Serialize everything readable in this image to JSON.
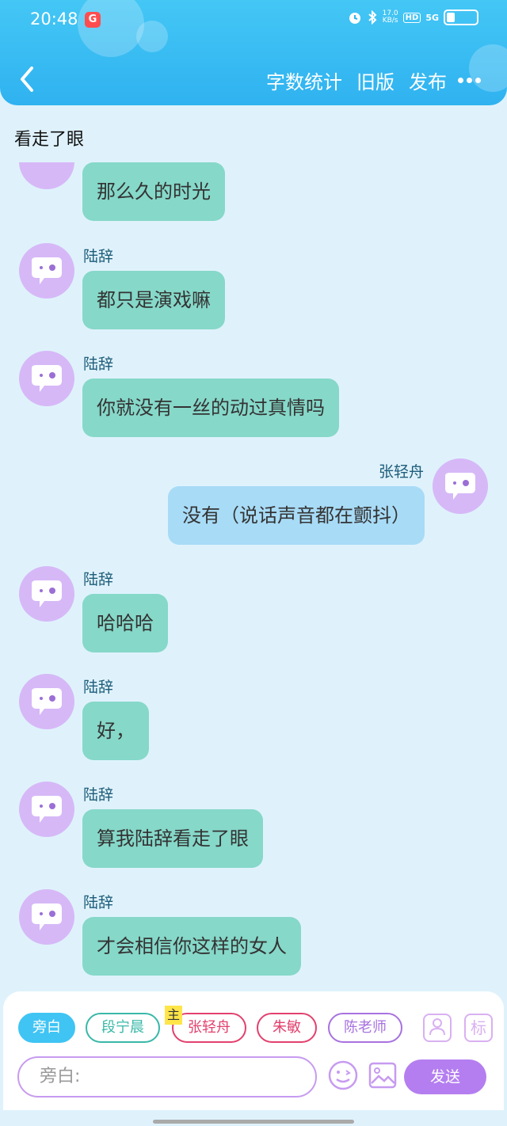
{
  "status_bar": {
    "time": "20:48",
    "net_speed": "17.0",
    "net_unit": "KB/s",
    "hd": "HD",
    "signal": "5G"
  },
  "header": {
    "actions": [
      "字数统计",
      "旧版",
      "发布"
    ]
  },
  "story_title": "看走了眼",
  "messages": [
    {
      "side": "left",
      "sender": "",
      "text": "那么久的时光"
    },
    {
      "side": "left",
      "sender": "陆辞",
      "text": "都只是演戏嘛"
    },
    {
      "side": "left",
      "sender": "陆辞",
      "text": "你就没有一丝的动过真情吗"
    },
    {
      "side": "right",
      "sender": "张轻舟",
      "text": "没有（说话声音都在颤抖）"
    },
    {
      "side": "left",
      "sender": "陆辞",
      "text": "哈哈哈"
    },
    {
      "side": "left",
      "sender": "陆辞",
      "text": "好，"
    },
    {
      "side": "left",
      "sender": "陆辞",
      "text": "算我陆辞看走了眼"
    },
    {
      "side": "left",
      "sender": "陆辞",
      "text": "才会相信你这样的女人"
    }
  ],
  "composer": {
    "roles": [
      "旁白",
      "段宁晨",
      "张轻舟",
      "朱敏",
      "陈老师"
    ],
    "main_tag": "主",
    "mark_label": "标",
    "input_placeholder": "旁白:",
    "send_label": "发送"
  },
  "colors": {
    "header": "#2fb2f0",
    "left_bubble": "#86d8c9",
    "right_bubble": "#a8dbf6",
    "avatar": "#d6b8f7",
    "send": "#b47ef0"
  }
}
